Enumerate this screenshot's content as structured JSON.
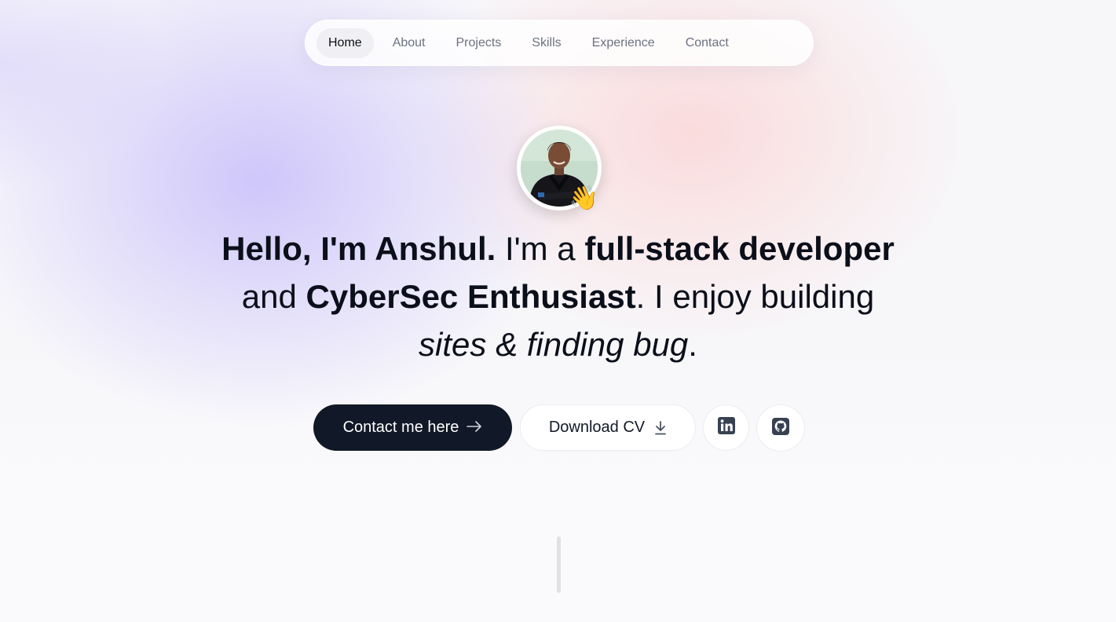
{
  "nav": {
    "items": [
      {
        "label": "Home",
        "active": true
      },
      {
        "label": "About",
        "active": false
      },
      {
        "label": "Projects",
        "active": false
      },
      {
        "label": "Skills",
        "active": false
      },
      {
        "label": "Experience",
        "active": false
      },
      {
        "label": "Contact",
        "active": false
      }
    ]
  },
  "avatar": {
    "icon": "person-photo",
    "badge_emoji": "👋"
  },
  "hero": {
    "line1_bold_a": "Hello, I'm Anshul.",
    "line1_text_a": " I'm a ",
    "line1_bold_b": "full-stack developer",
    "line2_text_a": "and ",
    "line2_bold_a": "CyberSec Enthusiast",
    "line2_text_b": ". I enjoy building",
    "line3_italic": "sites & finding bug",
    "line3_text": "."
  },
  "buttons": {
    "contact_label": "Contact me here",
    "contact_icon": "arrow-right-icon",
    "cv_label": "Download CV",
    "cv_icon": "download-icon",
    "linkedin_icon": "linkedin-icon",
    "github_icon": "github-icon"
  },
  "colors": {
    "primary_button": "#111827",
    "text": "#0b0f1a",
    "nav_text": "#6b7280"
  }
}
